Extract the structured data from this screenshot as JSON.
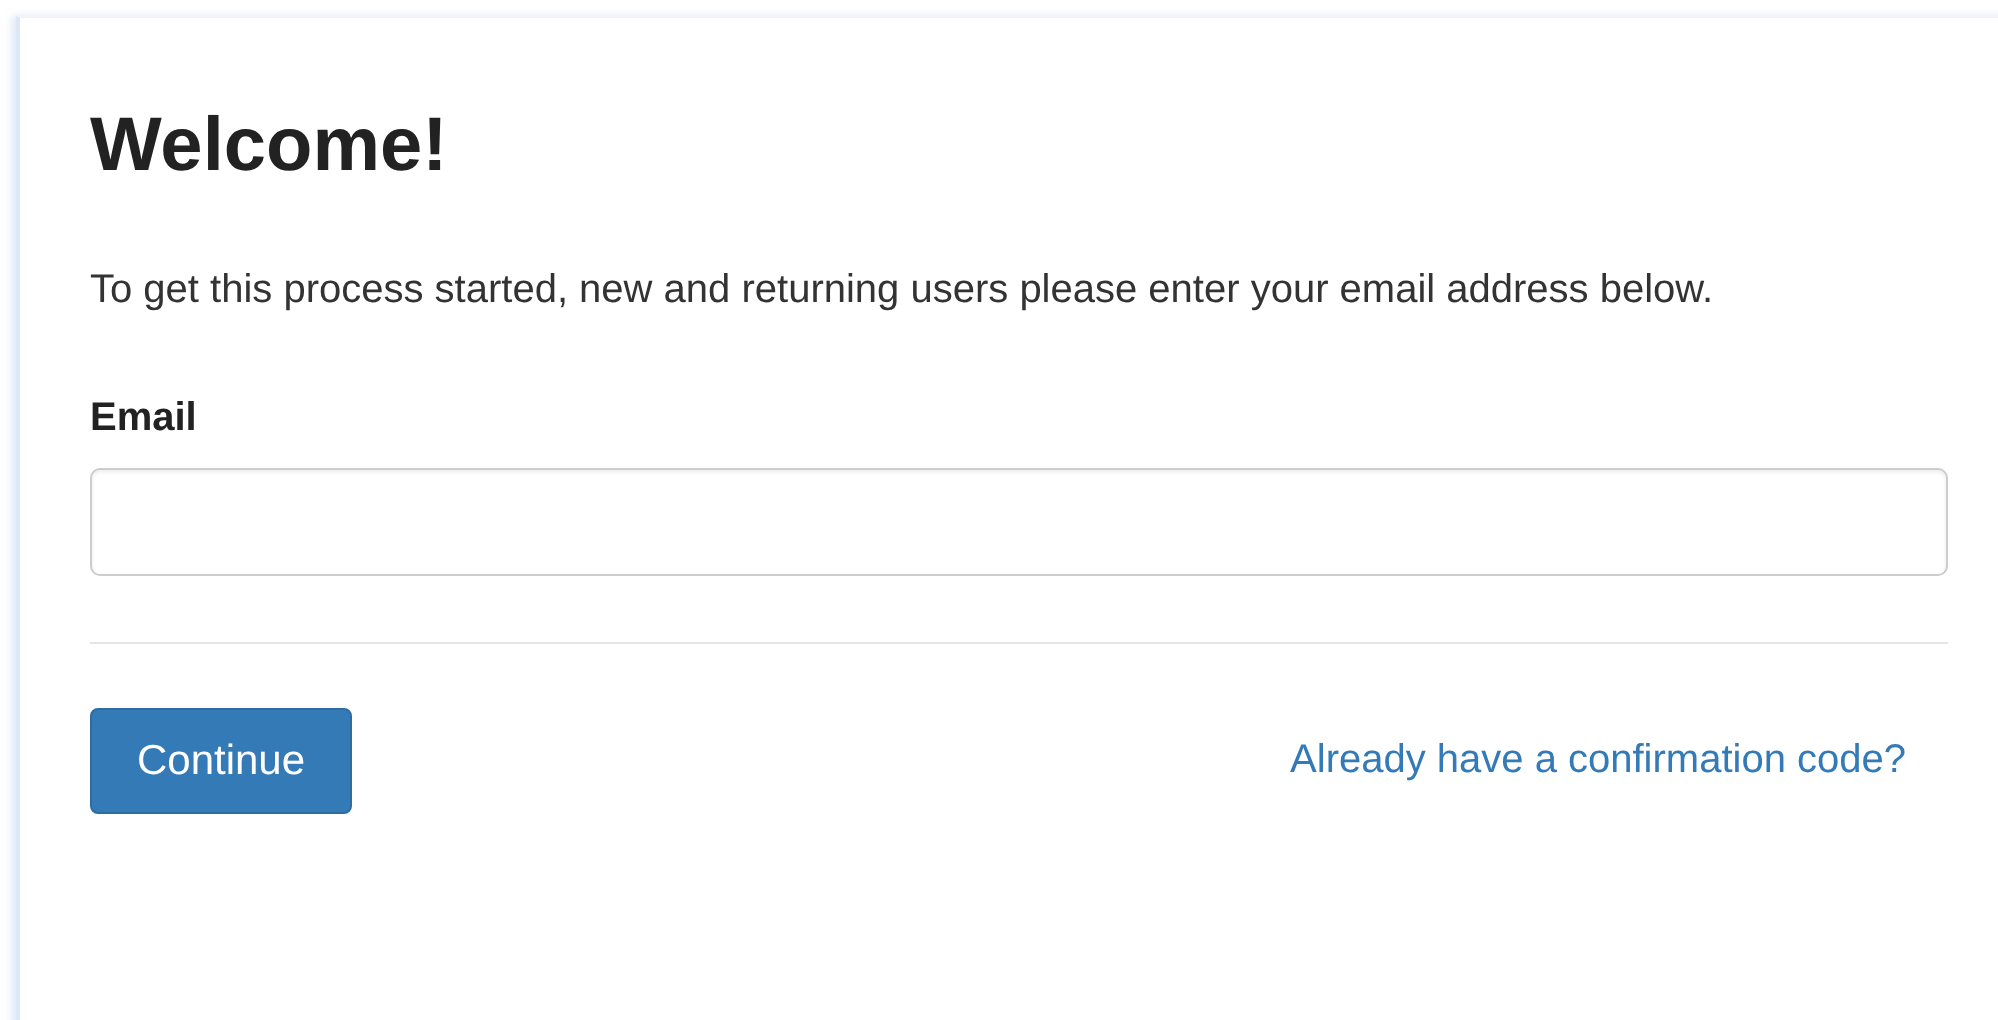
{
  "title": "Welcome!",
  "intro": "To get this process started, new and returning users please enter your email address below.",
  "email": {
    "label": "Email"
  },
  "continue_button": "Continue",
  "code_link": "Already have a confirmation code?"
}
